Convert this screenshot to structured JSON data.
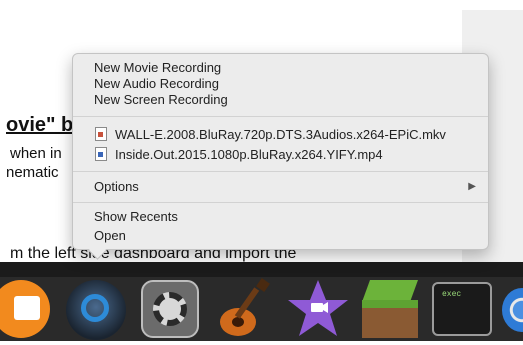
{
  "document": {
    "heading": "ovie\" b",
    "line1": "when in",
    "line2": "nematic",
    "line3": "m the left side dashboard and import the"
  },
  "menu": {
    "new_items": [
      "New Movie Recording",
      "New Audio Recording",
      "New Screen Recording"
    ],
    "recent_files": [
      "WALL-E.2008.BluRay.720p.DTS.3Audios.x264-EPiC.mkv",
      "Inside.Out.2015.1080p.BluRay.x264.YIFY.mp4"
    ],
    "options_label": "Options",
    "show_recents_label": "Show Recents",
    "open_label": "Open"
  },
  "dock": {
    "icons": [
      "ibooks-icon",
      "quicktime-icon",
      "system-preferences-icon",
      "garageband-icon",
      "imovie-icon",
      "minecraft-icon",
      "terminal-icon",
      "chrome-icon"
    ],
    "terminal_text": "exec"
  }
}
